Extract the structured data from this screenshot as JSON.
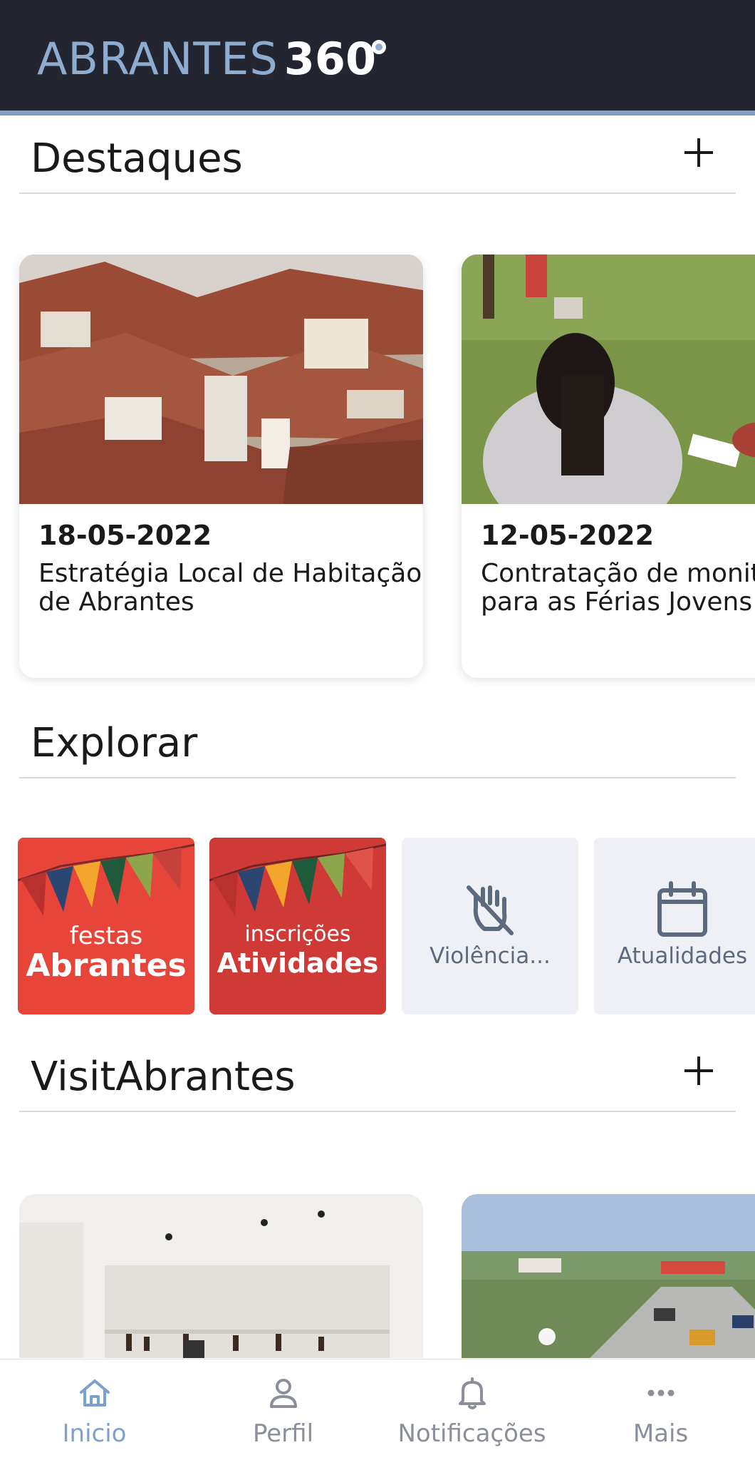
{
  "header": {
    "logo_primary": "ABRANTES",
    "logo_secondary": "360"
  },
  "destaques": {
    "title": "Destaques",
    "cards": [
      {
        "date": "18-05-2022",
        "title": "Estratégia Local de Habitação\nde Abrantes"
      },
      {
        "date": "12-05-2022",
        "title": "Contratação de monito\npara as Férias Jovens"
      }
    ]
  },
  "explorar": {
    "title": "Explorar",
    "tiles": [
      {
        "small": "festas",
        "big": "Abrantes"
      },
      {
        "small": "inscrições",
        "big": "Atividades"
      },
      {
        "label": "Violência...",
        "icon": "hand-off-icon"
      },
      {
        "label": "Atualidades",
        "icon": "calendar-icon"
      }
    ]
  },
  "visit": {
    "title": "VisitAbrantes"
  },
  "tabbar": {
    "items": [
      {
        "label": "Inicio",
        "icon": "home-icon",
        "active": true
      },
      {
        "label": "Perfil",
        "icon": "user-icon",
        "active": false
      },
      {
        "label": "Notificações",
        "icon": "bell-icon",
        "active": false
      },
      {
        "label": "Mais",
        "icon": "more-icon",
        "active": false
      }
    ]
  },
  "colors": {
    "header_bg": "#232530",
    "accent": "#7f9fc7",
    "festas_red": "#e8453a",
    "tile_grey": "#eef0f5"
  }
}
